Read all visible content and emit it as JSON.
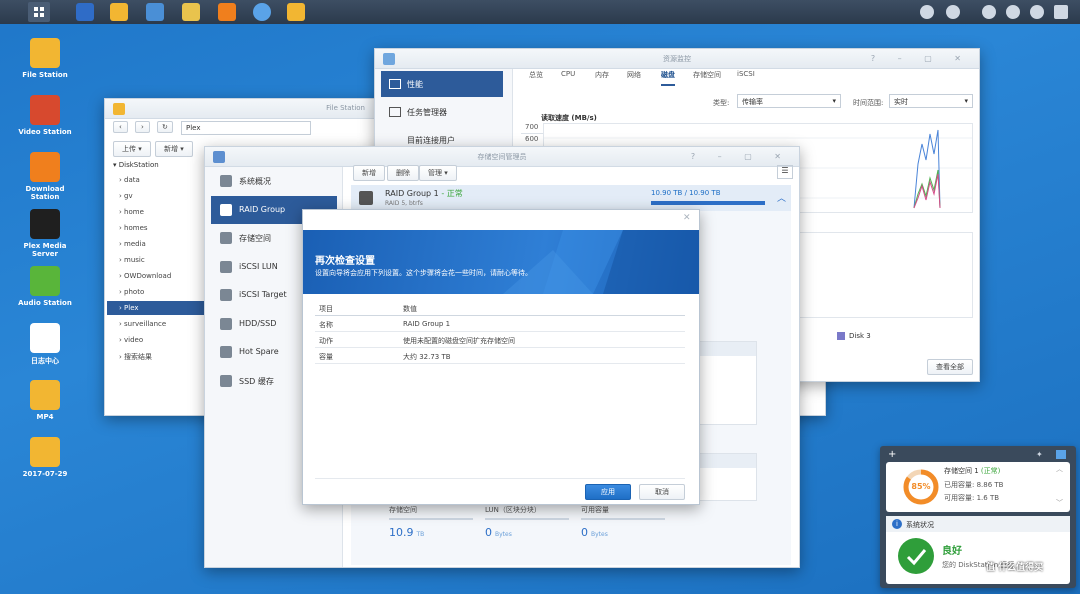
{
  "desktop": {
    "icons": [
      {
        "label": "File Station",
        "icon": "folder-search-icon",
        "color": "#f2b632"
      },
      {
        "label": "Video Station",
        "icon": "film-icon",
        "color": "#d7492e"
      },
      {
        "label": "Download Station",
        "icon": "download-arrow-icon",
        "color": "#f07f1d"
      },
      {
        "label": "Plex Media Server",
        "icon": "plex-icon",
        "color": "#1f1f1f"
      },
      {
        "label": "Audio Station",
        "icon": "music-note-icon",
        "color": "#59b53a"
      },
      {
        "label": "日志中心",
        "icon": "log-icon",
        "color": "#ffffff"
      },
      {
        "label": "MP4",
        "icon": "folder-icon",
        "color": "#f2b632"
      },
      {
        "label": "2017-07-29",
        "icon": "folder-icon",
        "color": "#f2b632"
      }
    ]
  },
  "file_station": {
    "title": "File Station",
    "path": "Plex",
    "toolbar": {
      "upload": "上传 ▾",
      "create": "新增 ▾"
    },
    "root": "DiskStation",
    "folders": [
      "data",
      "gv",
      "home",
      "homes",
      "media",
      "music",
      "OWDownload",
      "photo",
      "Plex",
      "surveillance",
      "video",
      "搜索结果"
    ],
    "selected_index": 8
  },
  "resource_monitor": {
    "title": "资源监控",
    "nav": [
      "性能",
      "任务管理器",
      "目前连接用户"
    ],
    "tabs": [
      "总览",
      "CPU",
      "内存",
      "网络",
      "磁盘",
      "存储空间",
      "iSCSI"
    ],
    "active_tab": 4,
    "type_label": "类型:",
    "type_value": "传输率",
    "range_label": "时间范围:",
    "range_value": "实时",
    "chart_title": "读取速度 (MB/s)",
    "y_ticks": [
      "700",
      "600"
    ],
    "legend": "Disk 3",
    "view_all": "查看全部"
  },
  "storage_manager": {
    "title": "存储空间管理员",
    "nav": [
      {
        "label": "系统概况"
      },
      {
        "label": "RAID Group"
      },
      {
        "label": "存储空间"
      },
      {
        "label": "iSCSI LUN"
      },
      {
        "label": "iSCSI Target"
      },
      {
        "label": "HDD/SSD"
      },
      {
        "label": "Hot Spare"
      },
      {
        "label": "SSD 缓存"
      }
    ],
    "active_nav": 1,
    "toolbar": {
      "create": "新增",
      "delete": "删除",
      "manage": "管理 ▾"
    },
    "raid": {
      "name": "RAID Group 1",
      "status": "- 正常",
      "subtitle": "RAID 5, btrfs",
      "capacity": "10.90 TB / 10.90 TB",
      "usage_fraction": 1.0
    },
    "summary": [
      {
        "label": "存储空间",
        "value": "10.9",
        "unit": "TB"
      },
      {
        "label": "LUN（区块分块）",
        "value": "0",
        "unit": "Bytes"
      },
      {
        "label": "可用容量",
        "value": "0",
        "unit": "Bytes"
      }
    ]
  },
  "dialog": {
    "title": "再次检查设置",
    "subtitle": "设置向导将会应用下列设置。这个步骤将会花一些时间，请耐心等待。",
    "columns": [
      "项目",
      "数值"
    ],
    "rows": [
      {
        "k": "名称",
        "v": "RAID Group 1"
      },
      {
        "k": "动作",
        "v": "使用未配置的磁盘空间扩充存储空间"
      },
      {
        "k": "容量",
        "v": "大约 32.73 TB"
      }
    ],
    "apply": "应用",
    "cancel": "取消"
  },
  "widget": {
    "volume_title": "存储空间 1",
    "volume_status": "(正常)",
    "used_label": "已用容量:",
    "used_value": "8.86 TB",
    "avail_label": "可用容量:",
    "avail_value": "1.6 TB",
    "percent": "85%",
    "percent_fraction": 0.85,
    "health_title": "系统状况",
    "health_status": "良好",
    "health_text": "您的 DiskStation 运行",
    "watermark": "值 什么值得买"
  },
  "colors": {
    "accent": "#2d5b9a",
    "primary_button": "#1f6fc6",
    "ok_green": "#3aa53a",
    "donut": "#f28c28"
  }
}
